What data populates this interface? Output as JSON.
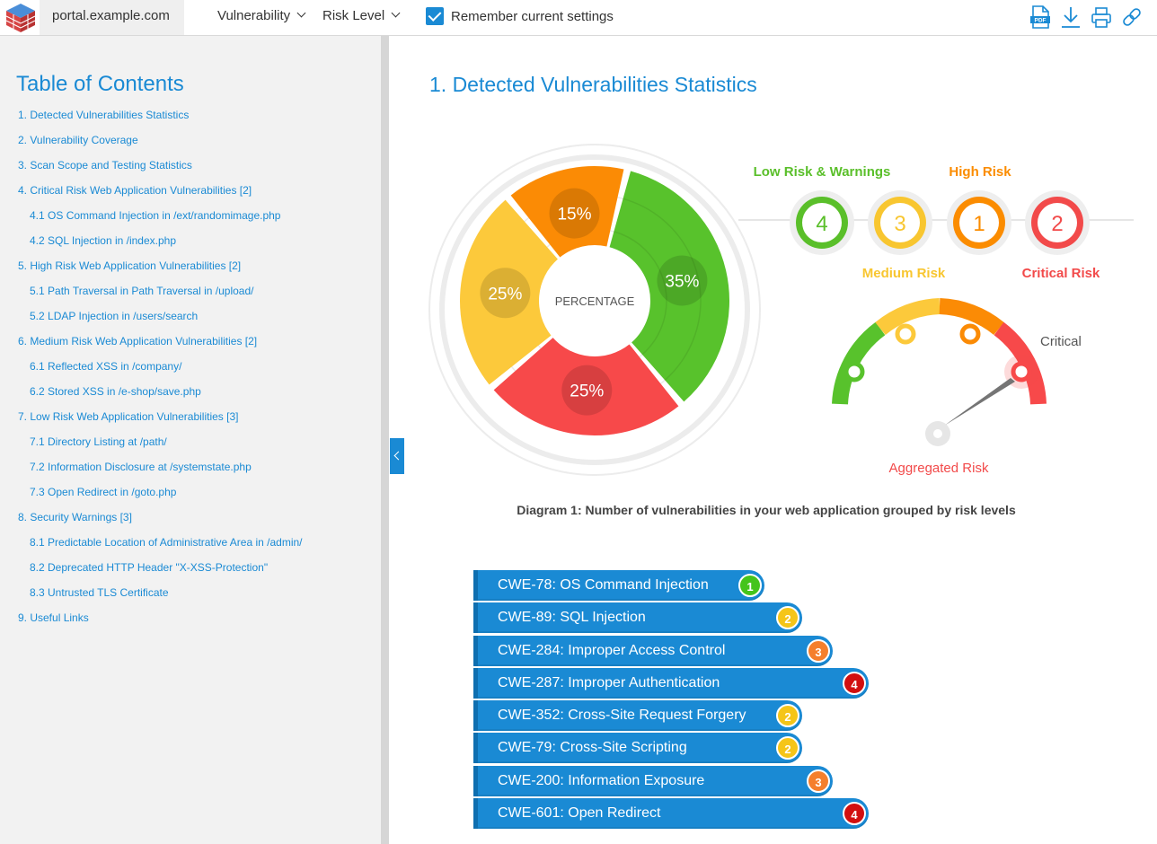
{
  "topbar": {
    "host": "portal.example.com",
    "vulnerability_label": "Vulnerability",
    "risk_level_label": "Risk Level",
    "remember_label": "Remember current settings",
    "remember_checked": true,
    "icons": [
      "pdf-icon",
      "download-icon",
      "print-icon",
      "link-icon"
    ]
  },
  "sidebar": {
    "title": "Table of Contents",
    "items": [
      {
        "label": "1. Detected Vulnerabilities Statistics",
        "sub": false
      },
      {
        "label": "2. Vulnerability Coverage",
        "sub": false
      },
      {
        "label": "3. Scan Scope and Testing Statistics",
        "sub": false
      },
      {
        "label": "4. Critical Risk Web Application Vulnerabilities [2]",
        "sub": false
      },
      {
        "label": "4.1 OS Command Injection in /ext/randomimage.php",
        "sub": true
      },
      {
        "label": "4.2 SQL Injection in /index.php",
        "sub": true
      },
      {
        "label": "5. High Risk Web Application Vulnerabilities [2]",
        "sub": false
      },
      {
        "label": "5.1 Path Traversal in Path Traversal in /upload/",
        "sub": true
      },
      {
        "label": "5.2 LDAP Injection in /users/search",
        "sub": true
      },
      {
        "label": "6. Medium Risk Web Application Vulnerabilities [2]",
        "sub": false
      },
      {
        "label": "6.1 Reflected XSS in /company/",
        "sub": true
      },
      {
        "label": "6.2 Stored XSS in /e-shop/save.php",
        "sub": true
      },
      {
        "label": "7. Low Risk Web Application Vulnerabilities [3]",
        "sub": false
      },
      {
        "label": "7.1 Directory Listing at /path/",
        "sub": true
      },
      {
        "label": "7.2 Information Disclosure at /systemstate.php",
        "sub": true
      },
      {
        "label": "7.3 Open Redirect in /goto.php",
        "sub": true
      },
      {
        "label": "8. Security Warnings [3]",
        "sub": false
      },
      {
        "label": "8.1 Predictable Location of Administrative Area in /admin/",
        "sub": true
      },
      {
        "label": "8.2 Deprecated HTTP Header \"X-XSS-Protection\"",
        "sub": true
      },
      {
        "label": "8.3 Untrusted TLS Certificate",
        "sub": true
      },
      {
        "label": "9. Useful Links",
        "sub": false
      }
    ]
  },
  "main": {
    "title": "1. Detected Vulnerabilities Statistics",
    "caption": "Diagram 1:  Number of vulnerabilities in your web application grouped by risk levels",
    "donut_center": "PERCENTAGE",
    "risk_counts": [
      {
        "label": "Low Risk & Warnings",
        "count": "4",
        "color": "#5abf2a"
      },
      {
        "label": "Medium Risk",
        "count": "3",
        "color": "#f8c630"
      },
      {
        "label": "High Risk",
        "count": "1",
        "color": "#fb8c00"
      },
      {
        "label": "Critical Risk",
        "count": "2",
        "color": "#f24a4a"
      }
    ],
    "gauge": {
      "current": "Critical",
      "label": "Aggregated Risk"
    },
    "cwe": [
      {
        "label": "CWE-78: OS Command Injection",
        "count": "1",
        "color": "#45c41c"
      },
      {
        "label": "CWE-89: SQL Injection",
        "count": "2",
        "color": "#f5c518"
      },
      {
        "label": "CWE-284: Improper Access Control",
        "count": "3",
        "color": "#f57f2c"
      },
      {
        "label": "CWE-287: Improper Authentication",
        "count": "4",
        "color": "#d20f0f"
      },
      {
        "label": "CWE-352: Cross-Site Request Forgery",
        "count": "2",
        "color": "#f5c518"
      },
      {
        "label": "CWE-79: Cross-Site Scripting",
        "count": "2",
        "color": "#f5c518"
      },
      {
        "label": "CWE-200: Information Exposure",
        "count": "3",
        "color": "#f57f2c"
      },
      {
        "label": "CWE-601: Open Redirect",
        "count": "4",
        "color": "#d20f0f"
      }
    ]
  },
  "chart_data": {
    "type": "pie",
    "categories": [
      "Low Risk & Warnings",
      "Medium Risk",
      "High Risk",
      "Critical Risk"
    ],
    "values": [
      35,
      25,
      15,
      25
    ],
    "value_labels": [
      "35%",
      "25%",
      "15%",
      "25%"
    ],
    "colors": [
      "#58c22c",
      "#fcc93b",
      "#fb8b05",
      "#f7494a"
    ]
  }
}
